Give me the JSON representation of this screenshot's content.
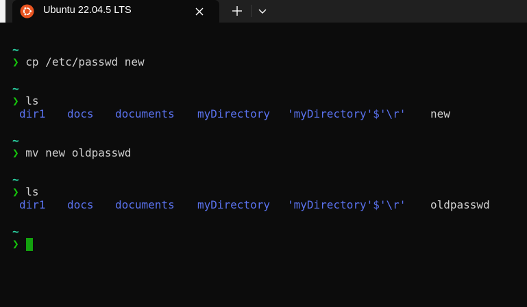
{
  "tab": {
    "title": "Ubuntu 22.04.5 LTS",
    "icon": "ubuntu-logo-icon",
    "close_icon": "close-icon",
    "new_tab_icon": "plus-icon",
    "dropdown_icon": "chevron-down-icon"
  },
  "colors": {
    "background": "#0c0c0c",
    "tabbar": "#202020",
    "prompt_tilde": "#2bd7a6",
    "prompt_arrow": "#16c60c",
    "directory": "#5a72ee",
    "text": "#cccccc",
    "cursor": "#13a10e"
  },
  "prompt": {
    "path": "~",
    "symbol": "❯"
  },
  "blocks": [
    {
      "command": "cp /etc/passwd new"
    },
    {
      "command": "ls",
      "output": [
        {
          "name": "dir1",
          "type": "dir"
        },
        {
          "name": "docs",
          "type": "dir"
        },
        {
          "name": "documents",
          "type": "dir"
        },
        {
          "name": "myDirectory",
          "type": "dir"
        },
        {
          "name": "'myDirectory'$'\\r'",
          "type": "dir"
        },
        {
          "name": "new",
          "type": "file"
        }
      ]
    },
    {
      "command": "mv new oldpasswd"
    },
    {
      "command": "ls",
      "output": [
        {
          "name": "dir1",
          "type": "dir"
        },
        {
          "name": "docs",
          "type": "dir"
        },
        {
          "name": "documents",
          "type": "dir"
        },
        {
          "name": "myDirectory",
          "type": "dir"
        },
        {
          "name": "'myDirectory'$'\\r'",
          "type": "dir"
        },
        {
          "name": "oldpasswd",
          "type": "file"
        }
      ]
    },
    {
      "command": ""
    }
  ]
}
